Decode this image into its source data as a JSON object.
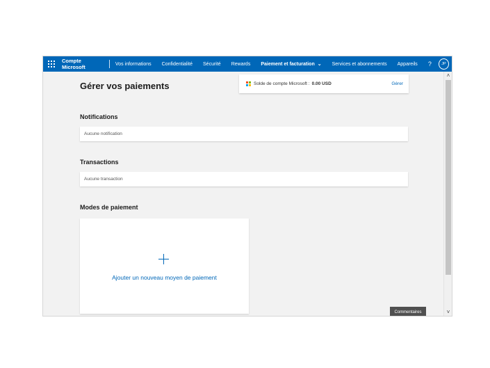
{
  "nav": {
    "brand": "Compte Microsoft",
    "items": [
      {
        "label": "Vos informations"
      },
      {
        "label": "Confidentialité"
      },
      {
        "label": "Sécurité"
      },
      {
        "label": "Rewards"
      },
      {
        "label": "Paiement et facturation",
        "active": true
      },
      {
        "label": "Services et abonnements"
      },
      {
        "label": "Appareils"
      }
    ],
    "help": "?",
    "avatar_initials": "JP"
  },
  "page": {
    "title": "Gérer vos paiements"
  },
  "balance": {
    "label": "Solde de compte Microsoft :",
    "amount": "0.00 USD",
    "manage_link": "Gérer"
  },
  "notifications": {
    "title": "Notifications",
    "empty_text": "Aucune notification"
  },
  "transactions": {
    "title": "Transactions",
    "empty_text": "Aucune transaction"
  },
  "payment_methods": {
    "title": "Modes de paiement",
    "add_label": "Ajouter un nouveau moyen de paiement"
  },
  "feedback_label": "Commentaires",
  "colors": {
    "accent": "#0067b8",
    "background": "#f2f2f2"
  }
}
